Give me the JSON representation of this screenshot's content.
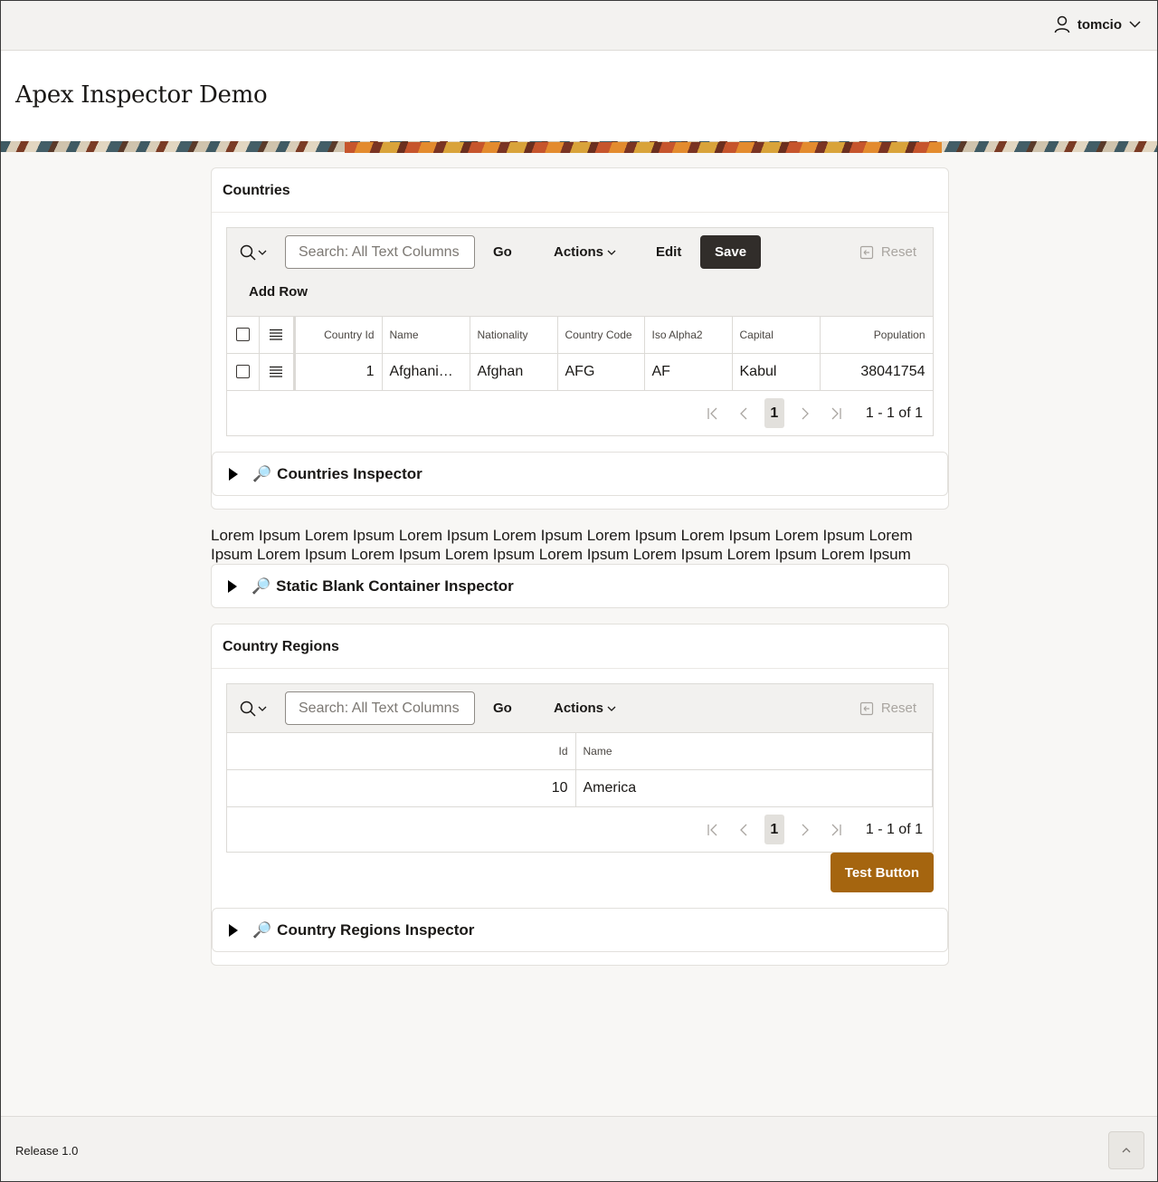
{
  "header": {
    "username": "tomcio"
  },
  "page": {
    "title": "Apex Inspector Demo"
  },
  "countries": {
    "title": "Countries",
    "toolbar": {
      "search_placeholder": "Search: All Text Columns",
      "go": "Go",
      "actions": "Actions",
      "edit": "Edit",
      "save": "Save",
      "reset": "Reset",
      "add_row": "Add Row"
    },
    "columns": [
      "Country Id",
      "Name",
      "Nationality",
      "Country Code",
      "Iso Alpha2",
      "Capital",
      "Population"
    ],
    "rows": [
      [
        "1",
        "Afghani…",
        "Afghan",
        "AFG",
        "AF",
        "Kabul",
        "38041754"
      ]
    ],
    "pager": {
      "current": "1",
      "range": "1 - 1 of 1"
    },
    "inspector": "Countries Inspector"
  },
  "static_text": "Lorem Ipsum Lorem Ipsum Lorem Ipsum Lorem Ipsum Lorem Ipsum Lorem Ipsum Lorem Ipsum Lorem Ipsum Lorem Ipsum Lorem Ipsum Lorem Ipsum Lorem Ipsum Lorem Ipsum Lorem Ipsum Lorem Ipsum",
  "static_inspector": "Static Blank Container Inspector",
  "regions": {
    "title": "Country Regions",
    "toolbar": {
      "search_placeholder": "Search: All Text Columns",
      "go": "Go",
      "actions": "Actions",
      "reset": "Reset"
    },
    "columns": [
      "Id",
      "Name"
    ],
    "rows": [
      [
        "10",
        "America"
      ]
    ],
    "pager": {
      "current": "1",
      "range": "1 - 1 of 1"
    },
    "test_button": "Test Button",
    "inspector": "Country Regions Inspector"
  },
  "footer": {
    "release": "Release 1.0"
  },
  "colors": {
    "save_button": "#312d2a",
    "test_button": "#a5650f",
    "background": "#f8f7f5"
  }
}
